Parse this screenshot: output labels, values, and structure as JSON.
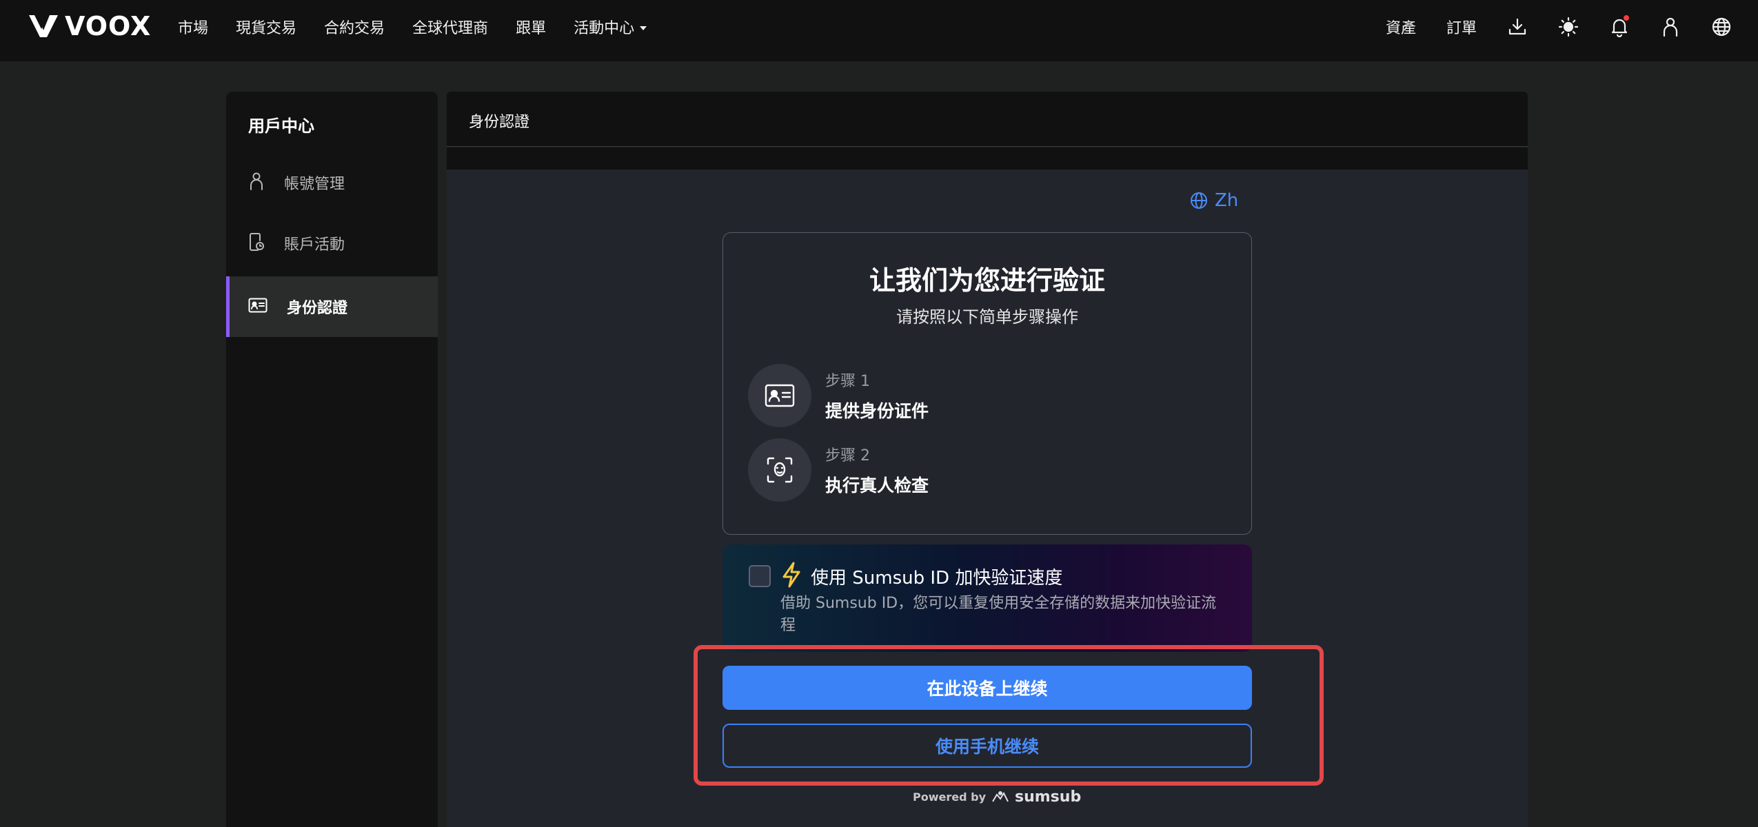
{
  "brand": {
    "name": "VOOX"
  },
  "nav": {
    "items": [
      "市場",
      "現貨交易",
      "合約交易",
      "全球代理商",
      "跟單",
      "活動中心"
    ]
  },
  "header_right": {
    "assets": "資產",
    "orders": "訂單",
    "icons": [
      "download-icon",
      "theme-sun-icon",
      "bell-icon",
      "user-icon",
      "globe-icon"
    ]
  },
  "sidebar": {
    "title": "用戶中心",
    "items": [
      {
        "label": "帳號管理",
        "icon": "user-icon"
      },
      {
        "label": "賬戶活動",
        "icon": "activity-icon"
      },
      {
        "label": "身份認證",
        "icon": "id-card-icon",
        "active": true
      }
    ]
  },
  "main": {
    "title": "身份認證",
    "language": "Zh"
  },
  "verify": {
    "title": "让我们为您进行验证",
    "subtitle": "请按照以下简单步骤操作",
    "steps": [
      {
        "num": "步骤 1",
        "desc": "提供身份证件",
        "icon": "id-card-icon"
      },
      {
        "num": "步骤 2",
        "desc": "执行真人检查",
        "icon": "face-scan-icon"
      }
    ]
  },
  "sumsub": {
    "title": "使用 Sumsub ID 加快验证速度",
    "desc": "借助 Sumsub ID，您可以重复使用安全存储的数据来加快验证流程",
    "checked": false
  },
  "actions": {
    "continue_here": "在此设备上继续",
    "continue_phone": "使用手机继续"
  },
  "footer": {
    "powered_by": "Powered by",
    "brand": "sumsub"
  },
  "colors": {
    "accent": "#3b82f6",
    "active_indicator": "#8b5cf6",
    "highlight": "#e04848",
    "notification": "#ff3b3b"
  }
}
